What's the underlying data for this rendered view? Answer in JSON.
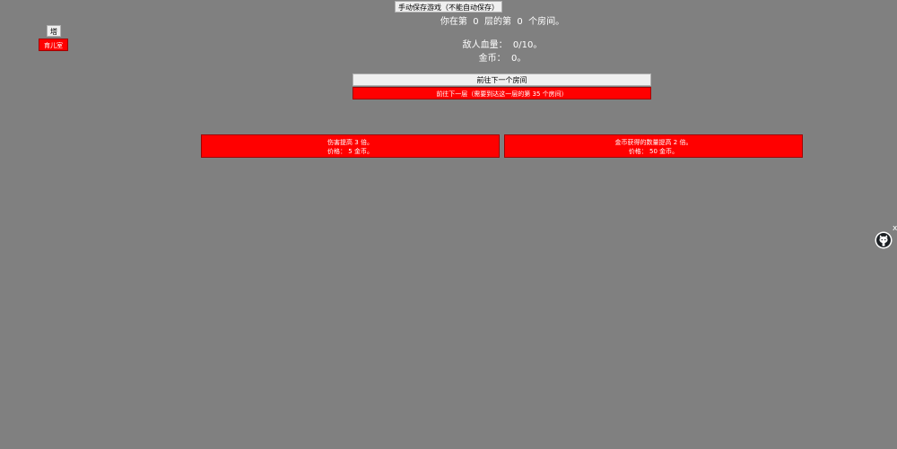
{
  "header": {
    "save_button": "手动保存游戏（不能自动保存）"
  },
  "sidebar": {
    "tab_label": "塔",
    "red_button": "育儿室"
  },
  "status": {
    "location": "你在第  0  层的第  0  个房间。",
    "enemy_hp": "敌人血量：  0/10。",
    "gold": "金币：  0。"
  },
  "navigation": {
    "next_room": "前往下一个房间",
    "next_floor": "前往下一层（需要到达这一层的第  35  个房间）"
  },
  "upgrades": [
    {
      "line1": "伤害提高  3  倍。",
      "line2": "价格：  5  金币。"
    },
    {
      "line1": "金币获得的数量提高  2  倍。",
      "line2": "价格：  50  金币。"
    }
  ],
  "floating": {
    "close": "x",
    "icon": "github-octocat-icon"
  }
}
